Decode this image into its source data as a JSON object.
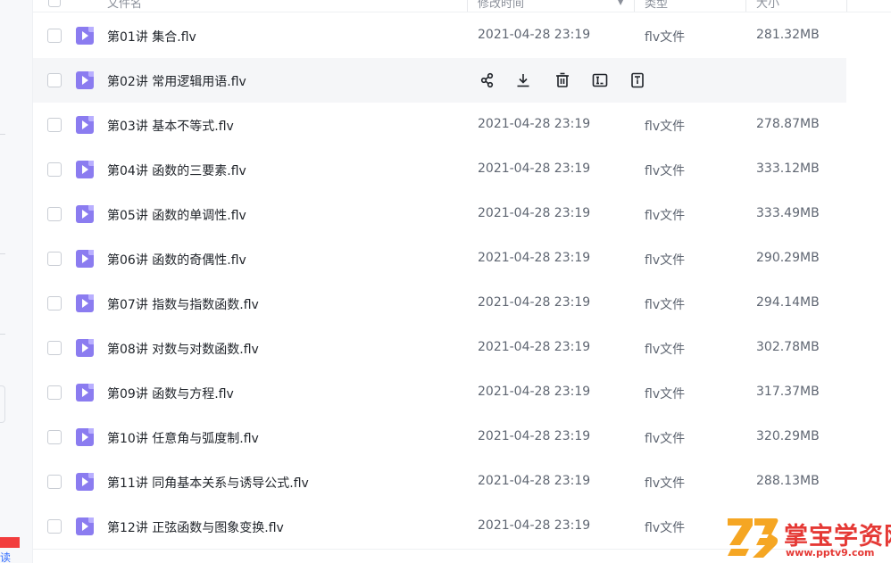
{
  "rail": {
    "bottom_text": "读"
  },
  "header": {
    "col_name": "文件名",
    "col_time": "修改时间",
    "col_type": "类型",
    "col_size": "大小"
  },
  "files": [
    {
      "name": "第01讲 集合.flv",
      "date": "2021-04-28 23:19",
      "type": "flv文件",
      "size": "281.32MB"
    },
    {
      "name": "第02讲 常用逻辑用语.flv",
      "date": "",
      "type": "",
      "size": "",
      "hover": true
    },
    {
      "name": "第03讲 基本不等式.flv",
      "date": "2021-04-28 23:19",
      "type": "flv文件",
      "size": "278.87MB"
    },
    {
      "name": "第04讲 函数的三要素.flv",
      "date": "2021-04-28 23:19",
      "type": "flv文件",
      "size": "333.12MB"
    },
    {
      "name": "第05讲 函数的单调性.flv",
      "date": "2021-04-28 23:19",
      "type": "flv文件",
      "size": "333.49MB"
    },
    {
      "name": "第06讲 函数的奇偶性.flv",
      "date": "2021-04-28 23:19",
      "type": "flv文件",
      "size": "290.29MB"
    },
    {
      "name": "第07讲 指数与指数函数.flv",
      "date": "2021-04-28 23:19",
      "type": "flv文件",
      "size": "294.14MB"
    },
    {
      "name": "第08讲 对数与对数函数.flv",
      "date": "2021-04-28 23:19",
      "type": "flv文件",
      "size": "302.78MB"
    },
    {
      "name": "第09讲 函数与方程.flv",
      "date": "2021-04-28 23:19",
      "type": "flv文件",
      "size": "317.37MB"
    },
    {
      "name": "第10讲 任意角与弧度制.flv",
      "date": "2021-04-28 23:19",
      "type": "flv文件",
      "size": "320.29MB"
    },
    {
      "name": "第11讲 同角基本关系与诱导公式.flv",
      "date": "2021-04-28 23:19",
      "type": "flv文件",
      "size": "288.13MB"
    },
    {
      "name": "第12讲 正弦函数与图象变换.flv",
      "date": "2021-04-28 23:19",
      "type": "flv文件",
      "size": ""
    }
  ],
  "row_actions": [
    "share-icon",
    "download-icon",
    "delete-icon",
    "rename-icon",
    "detail-icon"
  ],
  "file_icon": "video-file-icon",
  "watermark": {
    "title": "掌宝学资网",
    "url": "www.pptv9.com"
  },
  "colors": {
    "file_icon": "#8b7cf0",
    "hover_row": "#f5f6f8",
    "watermark": "#e53935",
    "accent_blue": "#2f6bff"
  }
}
